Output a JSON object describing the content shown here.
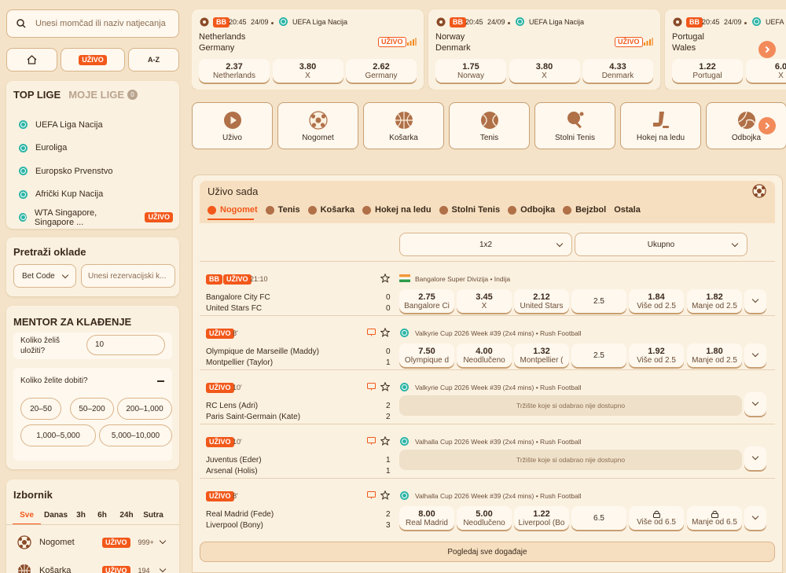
{
  "search": {
    "placeholder": "Unesi momčad ili naziv natjecanja"
  },
  "quicknav": {
    "live": "UŽIVO",
    "az": "A-Z"
  },
  "top_leagues": {
    "title": "TOP LIGE",
    "my_title": "MOJE LIGE",
    "my_count": "0",
    "items": [
      {
        "label": "UEFA Liga Nacija"
      },
      {
        "label": "Euroliga"
      },
      {
        "label": "Europsko Prvenstvo"
      },
      {
        "label": "Afrički Kup Nacija"
      },
      {
        "label": "WTA Singapore, Singapore ...",
        "badge": "UŽIVO"
      }
    ]
  },
  "bet_search": {
    "title": "Pretraži oklade",
    "select": "Bet Code",
    "placeholder": "Unesi rezervacijski k..."
  },
  "mentor": {
    "title": "MENTOR ZA KLAĐENJE",
    "stake_label": "Koliko želiš uložiti?",
    "stake_value": "10",
    "win_label": "Koliko želite dobiti?",
    "ranges": [
      "20–50",
      "50–200",
      "200–1,000",
      "1,000–5,000",
      "5,000–10,000"
    ]
  },
  "menu": {
    "title": "Izbornik",
    "tabs": [
      "Sve",
      "Danas",
      "3h",
      "6h",
      "24h",
      "Sutra"
    ],
    "items": [
      {
        "label": "Nogomet",
        "badge": "UŽIVO",
        "count": "999+"
      },
      {
        "label": "Košarka",
        "badge": "UŽIVO",
        "count": "194"
      }
    ]
  },
  "featured": [
    {
      "tag": "BB",
      "time": "20:45",
      "date": "24/09",
      "league": "UEFA Liga Nacija",
      "team1": "Netherlands",
      "team2": "Germany",
      "live": "UŽIVO",
      "odds": [
        {
          "v": "2.37",
          "l": "Netherlands"
        },
        {
          "v": "3.80",
          "l": "X"
        },
        {
          "v": "2.62",
          "l": "Germany"
        }
      ]
    },
    {
      "tag": "BB",
      "time": "20:45",
      "date": "24/09",
      "league": "UEFA Liga Nacija",
      "team1": "Norway",
      "team2": "Denmark",
      "live": "UŽIVO",
      "odds": [
        {
          "v": "1.75",
          "l": "Norway"
        },
        {
          "v": "3.80",
          "l": "X"
        },
        {
          "v": "4.33",
          "l": "Denmark"
        }
      ]
    },
    {
      "tag": "BB",
      "time": "20:45",
      "date": "24/09",
      "league": "UEFA Liga Nacija",
      "team1": "Portugal",
      "team2": "Wales",
      "live": "",
      "odds": [
        {
          "v": "1.22",
          "l": "Portugal"
        },
        {
          "v": "6.0",
          "l": "X"
        }
      ]
    }
  ],
  "sports": [
    {
      "label": "Uživo",
      "icon": "play-icon"
    },
    {
      "label": "Nogomet",
      "icon": "football-icon"
    },
    {
      "label": "Košarka",
      "icon": "basketball-icon"
    },
    {
      "label": "Tenis",
      "icon": "tennis-icon"
    },
    {
      "label": "Stolni Tenis",
      "icon": "table-tennis-icon"
    },
    {
      "label": "Hokej na ledu",
      "icon": "hockey-icon"
    },
    {
      "label": "Odbojka",
      "icon": "volleyball-icon"
    }
  ],
  "live_now": {
    "title": "Uživo sada",
    "tabs": [
      "Nogomet",
      "Tenis",
      "Košarka",
      "Hokej na ledu",
      "Stolni Tenis",
      "Odbojka",
      "Bejzbol",
      "Ostala"
    ],
    "market1": "1x2",
    "market2": "Ukupno",
    "unavailable": "Tržište koje si odabrao nije dostupno",
    "see_all": "Pogledaj sve događaje",
    "events": [
      {
        "bb": "BB",
        "live": "UŽIVO",
        "minute": "21:10",
        "league": "Bangalore Super Divizija • Indija",
        "team1": "Bangalore City FC",
        "team2": "United Stars FC",
        "s1": "0",
        "s2": "0",
        "odds": [
          {
            "v": "2.75",
            "l": "Bangalore Ci"
          },
          {
            "v": "3.45",
            "l": "X"
          },
          {
            "v": "2.12",
            "l": "United Stars"
          }
        ],
        "line": "2.5",
        "ou": [
          {
            "v": "1.84",
            "l": "Više od 2.5"
          },
          {
            "v": "1.82",
            "l": "Manje od 2.5"
          }
        ]
      },
      {
        "live": "UŽIVO",
        "minute": "8'",
        "league": "Valkyrie Cup 2026 Week #39 (2x4 mins) • Rush Football",
        "team1": "Olympique de Marseille (Maddy)",
        "team2": "Montpellier (Taylor)",
        "s1": "0",
        "s2": "1",
        "odds": [
          {
            "v": "7.50",
            "l": "Olympique d"
          },
          {
            "v": "4.00",
            "l": "Neodlučeno"
          },
          {
            "v": "1.32",
            "l": "Montpellier ("
          }
        ],
        "line": "2.5",
        "ou": [
          {
            "v": "1.92",
            "l": "Više od 2.5"
          },
          {
            "v": "1.80",
            "l": "Manje od 2.5"
          }
        ]
      },
      {
        "live": "UŽIVO",
        "minute": "10'",
        "league": "Valkyrie Cup 2026 Week #39 (2x4 mins) • Rush Football",
        "team1": "RC Lens (Adri)",
        "team2": "Paris Saint-Germain (Kate)",
        "s1": "2",
        "s2": "2"
      },
      {
        "live": "UŽIVO",
        "minute": "10'",
        "league": "Valhalla Cup 2026 Week #39 (2x4 mins) • Rush Football",
        "team1": "Juventus (Eder)",
        "team2": "Arsenal (Holis)",
        "s1": "1",
        "s2": "1"
      },
      {
        "live": "UŽIVO",
        "minute": "8'",
        "league": "Valhalla Cup 2026 Week #39 (2x4 mins) • Rush Football",
        "team1": "Real Madrid (Fede)",
        "team2": "Liverpool (Bony)",
        "s1": "2",
        "s2": "3",
        "odds": [
          {
            "v": "8.00",
            "l": "Real Madrid"
          },
          {
            "v": "5.00",
            "l": "Neodlučeno"
          },
          {
            "v": "1.22",
            "l": "Liverpool (Bo"
          }
        ],
        "line": "6.5",
        "ou": [
          {
            "v": "",
            "l": "Više od 6.5"
          },
          {
            "v": "",
            "l": "Manje od 6.5"
          }
        ]
      }
    ]
  }
}
